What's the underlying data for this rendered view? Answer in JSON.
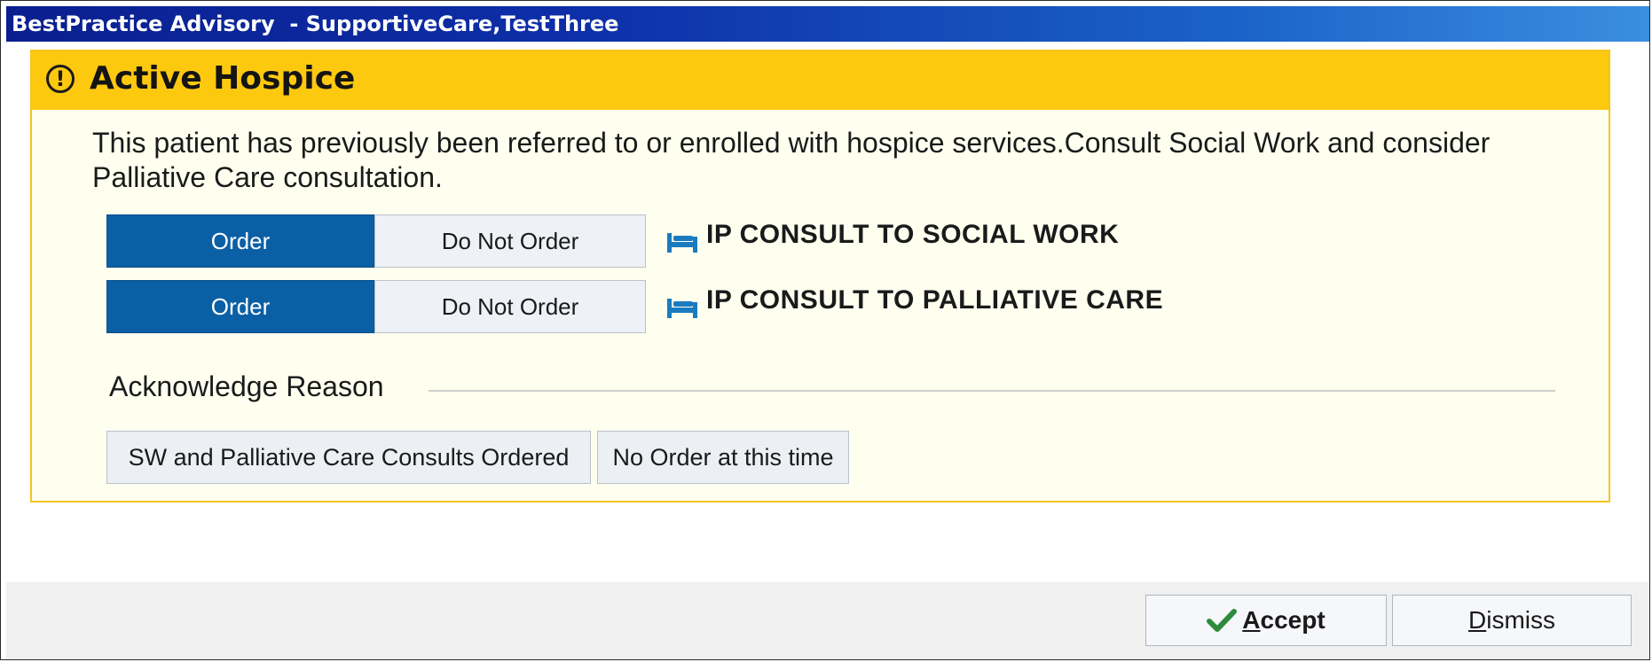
{
  "window": {
    "title": "BestPractice Advisory  - SupportiveCare,TestThree"
  },
  "advisory": {
    "title": "Active Hospice",
    "message": "This patient has previously been referred to or enrolled with hospice services.Consult Social Work and consider Palliative Care consultation.",
    "orders": [
      {
        "order_label": "Order",
        "do_not_order_label": "Do Not Order",
        "name": "IP CONSULT TO SOCIAL WORK",
        "icon": "hospital-bed-icon"
      },
      {
        "order_label": "Order",
        "do_not_order_label": "Do Not Order",
        "name": "IP CONSULT TO PALLIATIVE CARE",
        "icon": "hospital-bed-icon"
      }
    ],
    "acknowledge": {
      "label": "Acknowledge Reason",
      "options": [
        "SW and Palliative Care Consults Ordered",
        "No Order at this time"
      ]
    }
  },
  "footer": {
    "accept": {
      "mnemonic": "A",
      "rest": "ccept",
      "icon": "checkmark-icon"
    },
    "dismiss": {
      "mnemonic": "D",
      "rest": "ismiss"
    }
  },
  "colors": {
    "title_bar": "#0d2fa8",
    "header_yellow": "#fdc90f",
    "order_blue": "#0b5fa5",
    "check_green": "#2e8b3e"
  }
}
